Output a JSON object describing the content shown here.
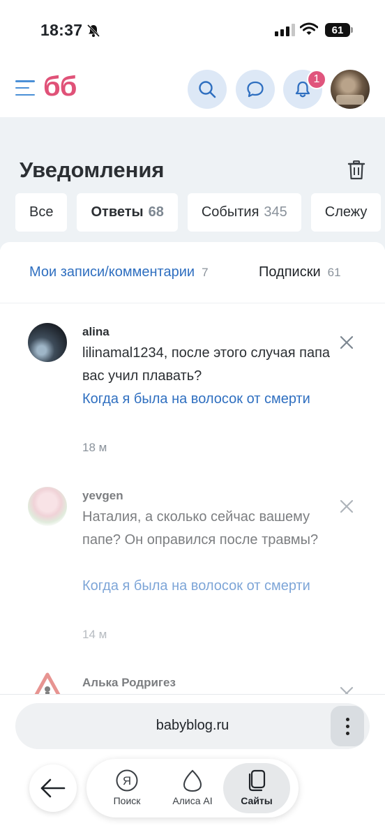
{
  "status": {
    "time": "18:37",
    "battery": "61"
  },
  "header": {
    "logo": "бб",
    "notifications_badge": "1"
  },
  "page": {
    "title": "Уведомления"
  },
  "tabs": [
    {
      "label": "Все",
      "count": ""
    },
    {
      "label": "Ответы",
      "count": "68"
    },
    {
      "label": "События",
      "count": "345"
    },
    {
      "label": "Слежу",
      "count": ""
    }
  ],
  "subtabs": [
    {
      "label": "Мои записи/комментарии",
      "count": "7"
    },
    {
      "label": "Подписки",
      "count": "61"
    }
  ],
  "notifications": [
    {
      "user": "alina",
      "text": "lilinamal1234, после этого случая папа вас учил плавать?",
      "link": "Когда я была на волосок от смерти",
      "time": "18 м"
    },
    {
      "user": "yevgen",
      "text": "Наталия, а сколько сейчас вашему папе? Он оправился после травмы?",
      "link": "Когда я была на волосок от смерти",
      "time": "14 м"
    },
    {
      "user": "Алька Родригез",
      "text": "",
      "link": "",
      "time": ""
    }
  ],
  "browser": {
    "url": "babyblog.ru",
    "nav": [
      {
        "label": "Поиск",
        "icon": "yandex-search-icon"
      },
      {
        "label": "Алиса AI",
        "icon": "alice-icon"
      },
      {
        "label": "Сайты",
        "icon": "tabs-icon"
      }
    ]
  },
  "colors": {
    "accent": "#2f6fc0",
    "brand": "#e05278",
    "badge": "#e0557d",
    "grey_bg": "#eef2f5"
  }
}
